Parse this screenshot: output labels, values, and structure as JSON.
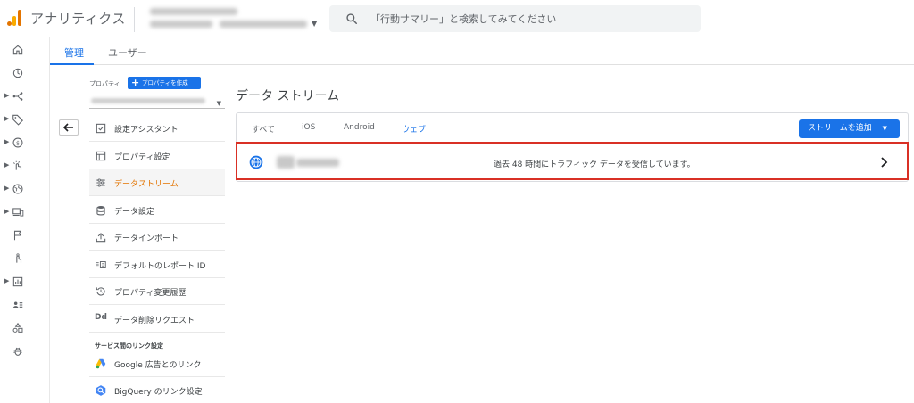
{
  "header": {
    "app_title": "アナリティクス",
    "search_placeholder": "「行動サマリー」と検索してみてください"
  },
  "tabs": {
    "admin": "管理",
    "user": "ユーザー"
  },
  "property": {
    "label": "プロパティ",
    "create_button": "プロパティを作成"
  },
  "menu": {
    "items": [
      {
        "label": "設定アシスタント",
        "icon": "checkbox-icon"
      },
      {
        "label": "プロパティ設定",
        "icon": "page-icon"
      },
      {
        "label": "データストリーム",
        "icon": "streams-icon"
      },
      {
        "label": "データ設定",
        "icon": "database-icon"
      },
      {
        "label": "データインポート",
        "icon": "upload-icon"
      },
      {
        "label": "デフォルトのレポート ID",
        "icon": "report-id-icon"
      },
      {
        "label": "プロパティ変更履歴",
        "icon": "history-icon"
      },
      {
        "label": "データ削除リクエスト",
        "icon": "dd-icon"
      }
    ],
    "section_label": "サービス間のリンク設定",
    "link_items": [
      {
        "label": "Google 広告とのリンク",
        "icon": "google-ads-icon"
      },
      {
        "label": "BigQuery のリンク設定",
        "icon": "bigquery-icon"
      }
    ]
  },
  "main": {
    "page_title": "データ ストリーム",
    "filters": [
      "すべて",
      "iOS",
      "Android",
      "ウェブ"
    ],
    "active_filter_index": 3,
    "add_stream_button": "ストリームを追加",
    "stream": {
      "status": "過去 48 時間にトラフィック データを受信しています。"
    }
  },
  "colors": {
    "accent_blue": "#1a73e8",
    "active_orange": "#e37400",
    "highlight_red": "#d93025"
  }
}
